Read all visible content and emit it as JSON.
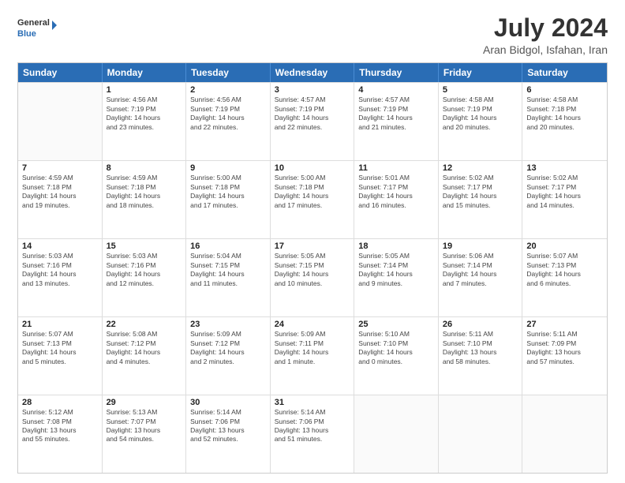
{
  "header": {
    "logo_line1": "General",
    "logo_line2": "Blue",
    "month_year": "July 2024",
    "location": "Aran Bidgol, Isfahan, Iran"
  },
  "weekdays": [
    "Sunday",
    "Monday",
    "Tuesday",
    "Wednesday",
    "Thursday",
    "Friday",
    "Saturday"
  ],
  "weeks": [
    [
      {
        "day": "",
        "info": ""
      },
      {
        "day": "1",
        "info": "Sunrise: 4:56 AM\nSunset: 7:19 PM\nDaylight: 14 hours\nand 23 minutes."
      },
      {
        "day": "2",
        "info": "Sunrise: 4:56 AM\nSunset: 7:19 PM\nDaylight: 14 hours\nand 22 minutes."
      },
      {
        "day": "3",
        "info": "Sunrise: 4:57 AM\nSunset: 7:19 PM\nDaylight: 14 hours\nand 22 minutes."
      },
      {
        "day": "4",
        "info": "Sunrise: 4:57 AM\nSunset: 7:19 PM\nDaylight: 14 hours\nand 21 minutes."
      },
      {
        "day": "5",
        "info": "Sunrise: 4:58 AM\nSunset: 7:19 PM\nDaylight: 14 hours\nand 20 minutes."
      },
      {
        "day": "6",
        "info": "Sunrise: 4:58 AM\nSunset: 7:18 PM\nDaylight: 14 hours\nand 20 minutes."
      }
    ],
    [
      {
        "day": "7",
        "info": "Sunrise: 4:59 AM\nSunset: 7:18 PM\nDaylight: 14 hours\nand 19 minutes."
      },
      {
        "day": "8",
        "info": "Sunrise: 4:59 AM\nSunset: 7:18 PM\nDaylight: 14 hours\nand 18 minutes."
      },
      {
        "day": "9",
        "info": "Sunrise: 5:00 AM\nSunset: 7:18 PM\nDaylight: 14 hours\nand 17 minutes."
      },
      {
        "day": "10",
        "info": "Sunrise: 5:00 AM\nSunset: 7:18 PM\nDaylight: 14 hours\nand 17 minutes."
      },
      {
        "day": "11",
        "info": "Sunrise: 5:01 AM\nSunset: 7:17 PM\nDaylight: 14 hours\nand 16 minutes."
      },
      {
        "day": "12",
        "info": "Sunrise: 5:02 AM\nSunset: 7:17 PM\nDaylight: 14 hours\nand 15 minutes."
      },
      {
        "day": "13",
        "info": "Sunrise: 5:02 AM\nSunset: 7:17 PM\nDaylight: 14 hours\nand 14 minutes."
      }
    ],
    [
      {
        "day": "14",
        "info": "Sunrise: 5:03 AM\nSunset: 7:16 PM\nDaylight: 14 hours\nand 13 minutes."
      },
      {
        "day": "15",
        "info": "Sunrise: 5:03 AM\nSunset: 7:16 PM\nDaylight: 14 hours\nand 12 minutes."
      },
      {
        "day": "16",
        "info": "Sunrise: 5:04 AM\nSunset: 7:15 PM\nDaylight: 14 hours\nand 11 minutes."
      },
      {
        "day": "17",
        "info": "Sunrise: 5:05 AM\nSunset: 7:15 PM\nDaylight: 14 hours\nand 10 minutes."
      },
      {
        "day": "18",
        "info": "Sunrise: 5:05 AM\nSunset: 7:14 PM\nDaylight: 14 hours\nand 9 minutes."
      },
      {
        "day": "19",
        "info": "Sunrise: 5:06 AM\nSunset: 7:14 PM\nDaylight: 14 hours\nand 7 minutes."
      },
      {
        "day": "20",
        "info": "Sunrise: 5:07 AM\nSunset: 7:13 PM\nDaylight: 14 hours\nand 6 minutes."
      }
    ],
    [
      {
        "day": "21",
        "info": "Sunrise: 5:07 AM\nSunset: 7:13 PM\nDaylight: 14 hours\nand 5 minutes."
      },
      {
        "day": "22",
        "info": "Sunrise: 5:08 AM\nSunset: 7:12 PM\nDaylight: 14 hours\nand 4 minutes."
      },
      {
        "day": "23",
        "info": "Sunrise: 5:09 AM\nSunset: 7:12 PM\nDaylight: 14 hours\nand 2 minutes."
      },
      {
        "day": "24",
        "info": "Sunrise: 5:09 AM\nSunset: 7:11 PM\nDaylight: 14 hours\nand 1 minute."
      },
      {
        "day": "25",
        "info": "Sunrise: 5:10 AM\nSunset: 7:10 PM\nDaylight: 14 hours\nand 0 minutes."
      },
      {
        "day": "26",
        "info": "Sunrise: 5:11 AM\nSunset: 7:10 PM\nDaylight: 13 hours\nand 58 minutes."
      },
      {
        "day": "27",
        "info": "Sunrise: 5:11 AM\nSunset: 7:09 PM\nDaylight: 13 hours\nand 57 minutes."
      }
    ],
    [
      {
        "day": "28",
        "info": "Sunrise: 5:12 AM\nSunset: 7:08 PM\nDaylight: 13 hours\nand 55 minutes."
      },
      {
        "day": "29",
        "info": "Sunrise: 5:13 AM\nSunset: 7:07 PM\nDaylight: 13 hours\nand 54 minutes."
      },
      {
        "day": "30",
        "info": "Sunrise: 5:14 AM\nSunset: 7:06 PM\nDaylight: 13 hours\nand 52 minutes."
      },
      {
        "day": "31",
        "info": "Sunrise: 5:14 AM\nSunset: 7:06 PM\nDaylight: 13 hours\nand 51 minutes."
      },
      {
        "day": "",
        "info": ""
      },
      {
        "day": "",
        "info": ""
      },
      {
        "day": "",
        "info": ""
      }
    ]
  ]
}
